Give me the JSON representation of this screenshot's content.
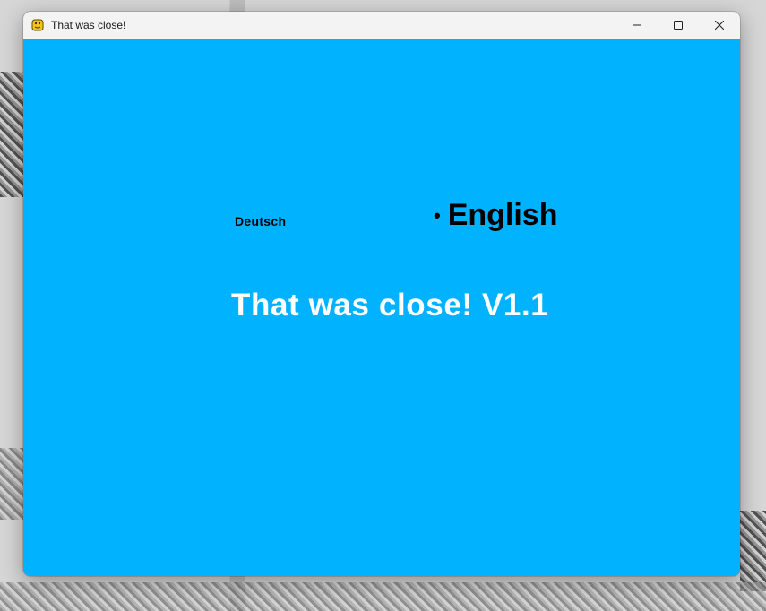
{
  "window": {
    "title": "That was close!",
    "controls": {
      "minimize_icon": "minimize-icon",
      "maximize_icon": "maximize-icon",
      "close_icon": "close-icon"
    }
  },
  "menu": {
    "languages": [
      {
        "label": "Deutsch",
        "selected": false
      },
      {
        "label": "English",
        "selected": true
      }
    ],
    "selected_marker": "•",
    "game_title": "That was close! V1.1"
  },
  "colors": {
    "background": "#00b2ff",
    "title_text": "#ffffff",
    "menu_text": "#000000"
  }
}
